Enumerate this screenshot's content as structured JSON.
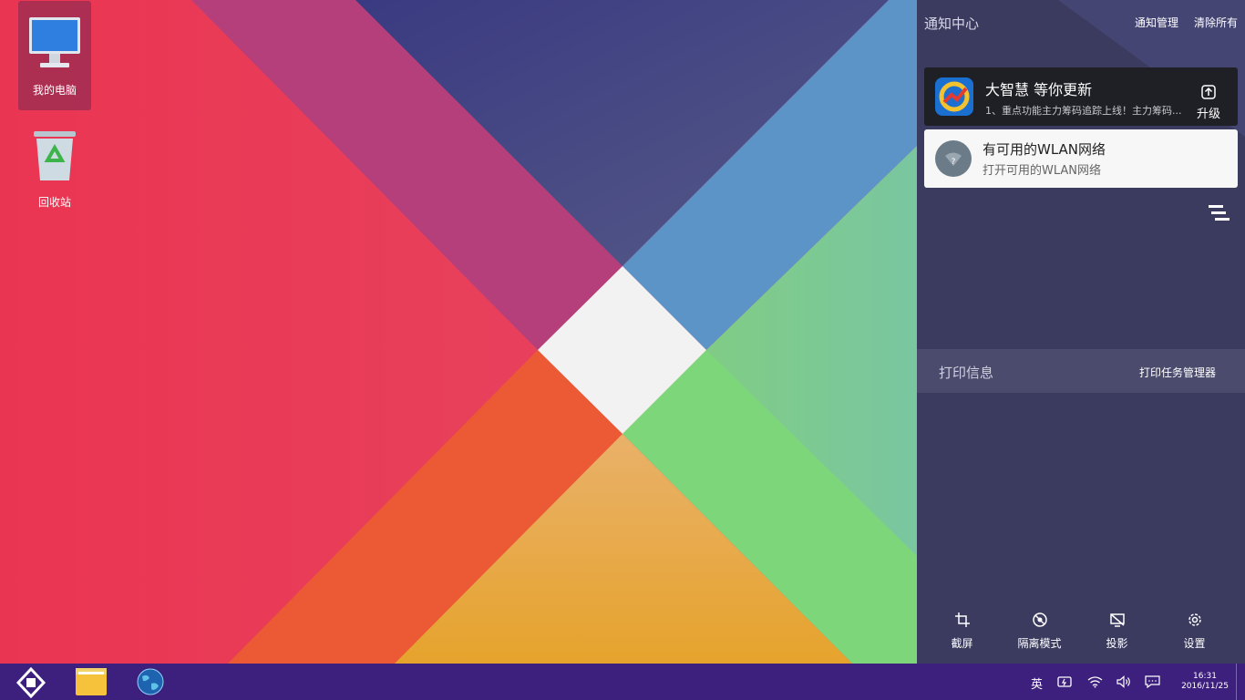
{
  "desktop": {
    "icons": [
      {
        "label": "我的电脑",
        "icon": "computer-icon"
      },
      {
        "label": "回收站",
        "icon": "recycle-bin-icon"
      }
    ]
  },
  "notification_center": {
    "title": "通知中心",
    "manage_label": "通知管理",
    "clear_all_label": "清除所有",
    "notifications": [
      {
        "title": "大智慧 等你更新",
        "text": "1、重点功能主力筹码追踪上线！主力筹码...",
        "action_label": "升级",
        "icon": "dazhihui-app-icon"
      },
      {
        "title": "有可用的WLAN网络",
        "text": "打开可用的WLAN网络",
        "icon": "wifi-question-icon"
      }
    ],
    "print_section": {
      "title": "打印信息",
      "manager_label": "打印任务管理器"
    },
    "quick_actions": [
      {
        "label": "截屏",
        "icon": "crop-icon"
      },
      {
        "label": "隔离模式",
        "icon": "isolation-icon"
      },
      {
        "label": "投影",
        "icon": "projection-icon"
      },
      {
        "label": "设置",
        "icon": "gear-icon"
      }
    ]
  },
  "taskbar": {
    "apps": [
      "start-icon",
      "file-manager-icon",
      "browser-globe-icon"
    ],
    "ime_label": "英",
    "time": "16:31",
    "date": "2016/11/25"
  },
  "colors": {
    "taskbar": "#3d1f7e",
    "panel": "#3b3b5f",
    "accent_red": "#e9375a"
  }
}
